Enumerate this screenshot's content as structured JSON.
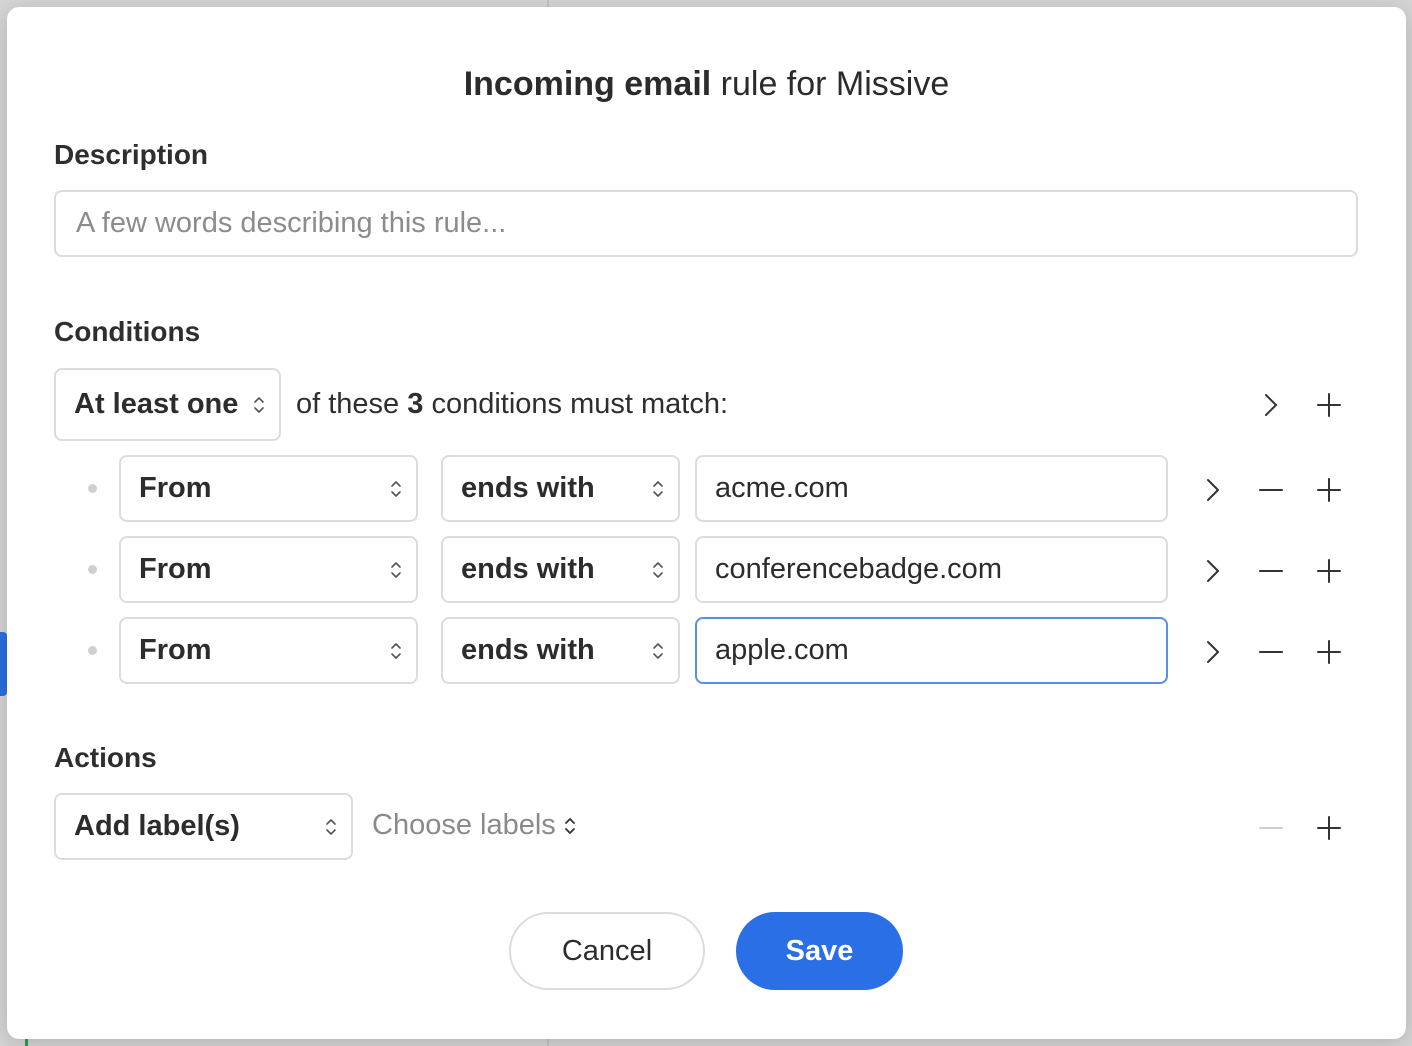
{
  "dialog": {
    "title_bold": "Incoming email",
    "title_rest": " rule for Missive"
  },
  "description": {
    "label": "Description",
    "placeholder": "A few words describing this rule...",
    "value": ""
  },
  "conditions": {
    "label": "Conditions",
    "match_mode": "At least one",
    "match_prefix": "of these ",
    "match_count": "3",
    "match_suffix": " conditions must match:",
    "rows": [
      {
        "field": "From",
        "operator": "ends with",
        "value": "acme.com"
      },
      {
        "field": "From",
        "operator": "ends with",
        "value": "conferencebadge.com"
      },
      {
        "field": "From",
        "operator": "ends with",
        "value": "apple.com"
      }
    ]
  },
  "actions": {
    "label": "Actions",
    "action": "Add label(s)",
    "labels_placeholder": "Choose labels"
  },
  "footer": {
    "cancel_label": "Cancel",
    "save_label": "Save"
  },
  "colors": {
    "primary": "#2b6fe6",
    "focus_border": "#5b8fe6",
    "border": "#dcdcdc"
  }
}
